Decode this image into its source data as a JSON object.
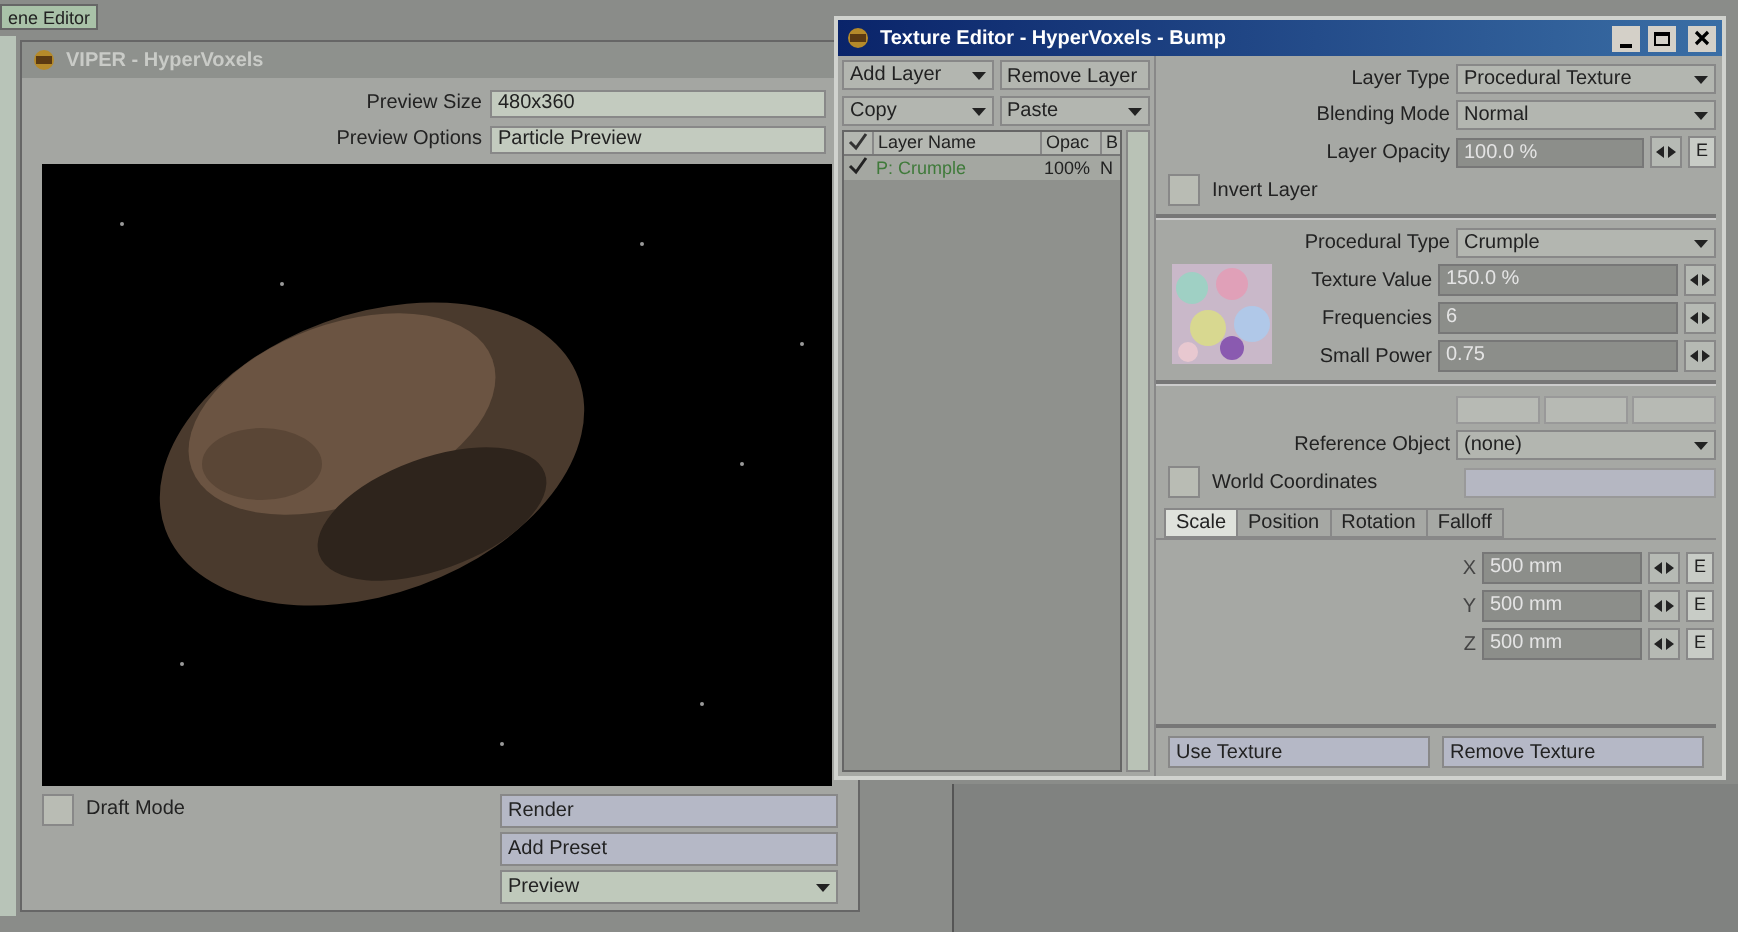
{
  "background": {
    "tabs": [
      {
        "label": "ene Editor"
      }
    ]
  },
  "viper": {
    "title": "VIPER - HyperVoxels",
    "fields": [
      {
        "label": "Preview Size",
        "value": "480x360"
      },
      {
        "label": "Preview Options",
        "value": "Particle Preview"
      }
    ],
    "draft_mode": {
      "label": "Draft Mode",
      "checked": false
    },
    "buttons": [
      {
        "label": "Render",
        "kind": "button"
      },
      {
        "label": "Add Preset",
        "kind": "button"
      },
      {
        "label": "Preview",
        "kind": "dropdown"
      }
    ]
  },
  "texture_editor": {
    "title": "Texture Editor - HyperVoxels - Bump",
    "toolbar": [
      {
        "label": "Add Layer",
        "kind": "dropdown"
      },
      {
        "label": "Remove Layer",
        "kind": "button"
      },
      {
        "label": "Copy",
        "kind": "dropdown"
      },
      {
        "label": "Paste",
        "kind": "dropdown"
      }
    ],
    "layer_list": {
      "columns": [
        "Layer Name",
        "Opac",
        "B"
      ],
      "rows": [
        {
          "enabled": true,
          "name": "P: Crumple",
          "opacity": "100%",
          "blend": "N"
        }
      ]
    },
    "layer_settings": [
      {
        "label": "Layer Type",
        "value": "Procedural Texture",
        "kind": "dropdown"
      },
      {
        "label": "Blending Mode",
        "value": "Normal",
        "kind": "dropdown"
      },
      {
        "label": "Layer Opacity",
        "value": "100.0 %",
        "kind": "number",
        "envelope": "E"
      }
    ],
    "invert_layer": {
      "label": "Invert Layer",
      "checked": false
    },
    "procedural_type": {
      "label": "Procedural Type",
      "value": "Crumple"
    },
    "params": [
      {
        "label": "Texture Value",
        "value": "150.0 %"
      },
      {
        "label": "Frequencies",
        "value": "6"
      },
      {
        "label": "Small Power",
        "value": "0.75"
      }
    ],
    "reference_object": {
      "label": "Reference Object",
      "value": "(none)"
    },
    "world_coordinates": {
      "label": "World Coordinates",
      "checked": false
    },
    "tabs": [
      {
        "label": "Scale",
        "selected": true
      },
      {
        "label": "Position",
        "selected": false
      },
      {
        "label": "Rotation",
        "selected": false
      },
      {
        "label": "Falloff",
        "selected": false
      }
    ],
    "axes": [
      {
        "label": "X",
        "value": "500 mm",
        "envelope": "E"
      },
      {
        "label": "Y",
        "value": "500 mm",
        "envelope": "E"
      },
      {
        "label": "Z",
        "value": "500 mm",
        "envelope": "E"
      }
    ],
    "buttons": [
      "Use Texture",
      "Remove Texture"
    ]
  }
}
